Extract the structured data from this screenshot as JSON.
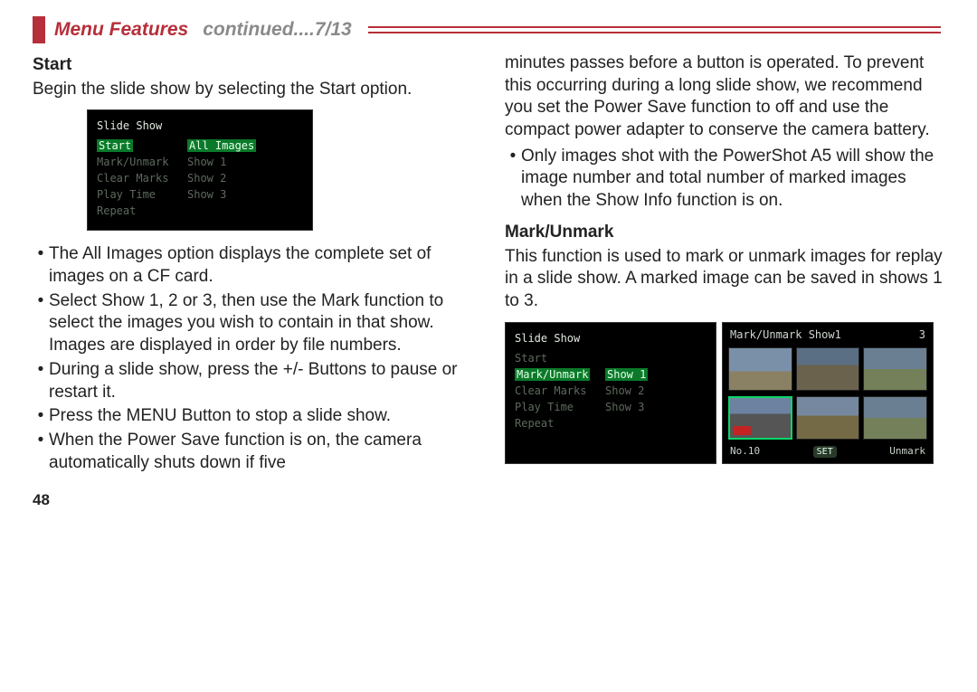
{
  "header": {
    "title": "Menu Features",
    "subtitle": "continued....7/13"
  },
  "left": {
    "start_heading": "Start",
    "start_intro": "Begin the slide show by selecting the Start option.",
    "screen1": {
      "title": "Slide Show",
      "rows": [
        {
          "l": "Start",
          "r": "All Images",
          "hlL": true,
          "hlR": true
        },
        {
          "l": "Mark/Unmark",
          "r": "Show 1"
        },
        {
          "l": "Clear Marks",
          "r": "Show 2"
        },
        {
          "l": "Play Time",
          "r": "Show 3"
        },
        {
          "l": "Repeat",
          "r": ""
        }
      ]
    },
    "bullets": [
      "The All Images option displays the complete set of images on a CF card.",
      "Select Show 1, 2 or 3, then use the Mark function to select the images you wish to contain in that show. Images are displayed in order by file numbers.",
      "During a slide show, press the +/- Buttons to pause or restart it.",
      "Press the MENU Button to stop a slide show.",
      "When the Power Save function is on, the camera automatically shuts down if five"
    ]
  },
  "right": {
    "cont_text": "minutes passes before a button is operated. To prevent this occurring during a long slide show, we recommend you set the Power Save function to off and use the compact power adapter to conserve the camera battery.",
    "bullet2": "Only images shot with the PowerShot A5 will show the image number and total number of marked images when the Show Info function is on.",
    "mark_heading": "Mark/Unmark",
    "mark_intro": "This function is used to mark or unmark images for replay in a slide show. A marked image can be saved in shows 1 to 3.",
    "screen2": {
      "title": "Slide Show",
      "rows": [
        {
          "l": "Start",
          "r": ""
        },
        {
          "l": "Mark/Unmark",
          "r": "Show 1",
          "hlL": true,
          "hlR": true
        },
        {
          "l": "Clear Marks",
          "r": "Show 2"
        },
        {
          "l": "Play Time",
          "r": "Show 3"
        },
        {
          "l": "Repeat",
          "r": ""
        }
      ]
    },
    "screen3": {
      "title_l": "Mark/Unmark Show1",
      "title_r": "3",
      "foot_l": "No.10",
      "foot_mid": "SET",
      "foot_r": "Unmark"
    }
  },
  "page_number": "48"
}
